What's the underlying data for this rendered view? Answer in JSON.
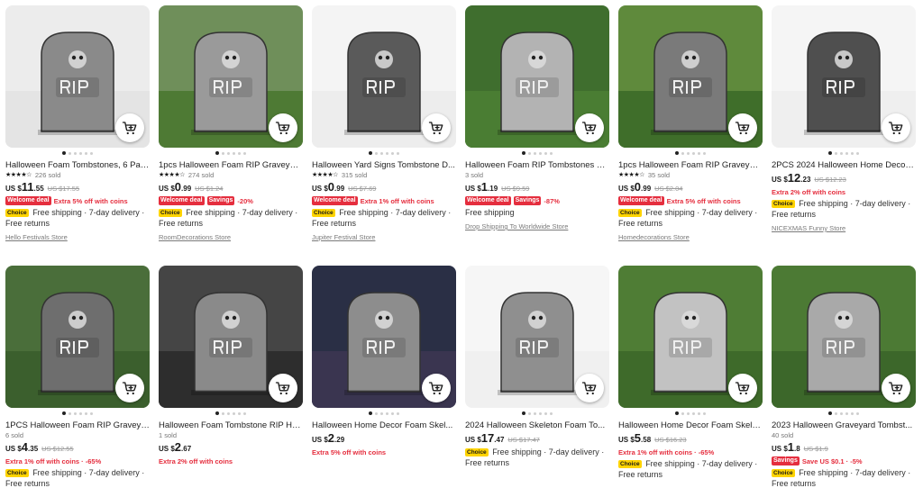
{
  "colors": {
    "accent_red": "#e52e3e",
    "choice_yellow": "#ffd400",
    "text": "#191919",
    "muted": "#9a9a9a"
  },
  "cart_icon": "add-to-cart-icon",
  "products": [
    {
      "title": "Halloween Foam Tombstones, 6 Pac...",
      "stars": "★★★★☆",
      "sold": "226 sold",
      "currency": "US $",
      "price_int": "11",
      "price_dec": ".55",
      "orig_price": "US $17.55",
      "badge": "Welcome deal",
      "badge2": "",
      "promo_text": "Extra 5% off with coins",
      "choice": "Choice",
      "shipping": "Free shipping · 7-day delivery · Free returns",
      "store": "Hello Festivals Store"
    },
    {
      "title": "1pcs Halloween Foam RIP Graveyar...",
      "stars": "★★★★☆",
      "sold": "274 sold",
      "currency": "US $",
      "price_int": "0",
      "price_dec": ".99",
      "orig_price": "US $1.24",
      "badge": "Welcome deal",
      "badge2": "Savings",
      "promo_text": "-20%",
      "choice": "Choice",
      "shipping": "Free shipping · 7-day delivery · Free returns",
      "store": "RoomDecorations Store"
    },
    {
      "title": "Halloween Yard Signs Tombstone D...",
      "stars": "★★★★☆",
      "sold": "315 sold",
      "currency": "US $",
      "price_int": "0",
      "price_dec": ".99",
      "orig_price": "US $7.69",
      "badge": "Welcome deal",
      "badge2": "",
      "promo_text": "Extra 1% off with coins",
      "choice": "Choice",
      "shipping": "Free shipping · 7-day delivery · Free returns",
      "store": "Jupiter Festival Store"
    },
    {
      "title": "Halloween Foam RIP Tombstones G...",
      "stars": "",
      "sold": "3 sold",
      "currency": "US $",
      "price_int": "1",
      "price_dec": ".19",
      "orig_price": "US $9.59",
      "badge": "Welcome deal",
      "badge2": "Savings",
      "promo_text": "-87%",
      "choice": "",
      "shipping": "Free shipping",
      "store": "Drop Shipping To Worldwide Store"
    },
    {
      "title": "1pcs Halloween Foam RIP Graveyar...",
      "stars": "★★★★☆",
      "sold": "35 sold",
      "currency": "US $",
      "price_int": "0",
      "price_dec": ".99",
      "orig_price": "US $2.04",
      "badge": "Welcome deal",
      "badge2": "",
      "promo_text": "Extra 5% off with coins",
      "choice": "Choice",
      "shipping": "Free shipping · 7-day delivery · Free returns",
      "store": "Homedecorations Store"
    },
    {
      "title": "2PCS 2024 Halloween Home Decora...",
      "stars": "",
      "sold": "",
      "currency": "US $",
      "price_int": "12",
      "price_dec": ".23",
      "orig_price": "US $12.23",
      "badge": "",
      "badge2": "",
      "promo_text": "Extra 2% off with coins",
      "choice": "Choice",
      "shipping": "Free shipping · 7-day delivery · Free returns",
      "store": "NICEXMAS Funny Store"
    },
    {
      "title": "1PCS Halloween Foam RIP Graveyar...",
      "stars": "",
      "sold": "6 sold",
      "currency": "US $",
      "price_int": "4",
      "price_dec": ".35",
      "orig_price": "US $12.55",
      "badge": "",
      "badge2": "",
      "promo_text": "Extra 1% off with coins · -65%",
      "choice": "Choice",
      "shipping": "Free shipping · 7-day delivery · Free returns",
      "store": ""
    },
    {
      "title": "Halloween Foam Tombstone RIP Ho...",
      "stars": "",
      "sold": "1 sold",
      "currency": "US $",
      "price_int": "2",
      "price_dec": ".67",
      "orig_price": "",
      "badge": "",
      "badge2": "",
      "promo_text": "Extra 2% off with coins",
      "choice": "",
      "shipping": "",
      "store": ""
    },
    {
      "title": "Halloween Home Decor Foam Skel...",
      "stars": "",
      "sold": "",
      "currency": "US $",
      "price_int": "2",
      "price_dec": ".29",
      "orig_price": "",
      "badge": "",
      "badge2": "",
      "promo_text": "Extra 5% off with coins",
      "choice": "",
      "shipping": "",
      "store": ""
    },
    {
      "title": "2024 Halloween Skeleton Foam To...",
      "stars": "",
      "sold": "",
      "currency": "US $",
      "price_int": "17",
      "price_dec": ".47",
      "orig_price": "US $17.47",
      "badge": "",
      "badge2": "",
      "promo_text": "",
      "choice": "Choice",
      "shipping": "Free shipping · 7-day delivery · Free returns",
      "store": ""
    },
    {
      "title": "Halloween Home Decor Foam Skele...",
      "stars": "",
      "sold": "",
      "currency": "US $",
      "price_int": "5",
      "price_dec": ".58",
      "orig_price": "US $16.23",
      "badge": "",
      "badge2": "",
      "promo_text": "Extra 1% off with coins · -65%",
      "choice": "Choice",
      "shipping": "Free shipping · 7-day delivery · Free returns",
      "store": ""
    },
    {
      "title": "2023 Halloween Graveyard Tombst...",
      "stars": "",
      "sold": "40 sold",
      "currency": "US $",
      "price_int": "1",
      "price_dec": ".8",
      "orig_price": "US $1.9",
      "badge": "Savings",
      "badge2": "",
      "promo_text": "Save US $0.1 · -5%",
      "choice": "Choice",
      "shipping": "Free shipping · 7-day delivery · Free returns",
      "store": ""
    }
  ]
}
